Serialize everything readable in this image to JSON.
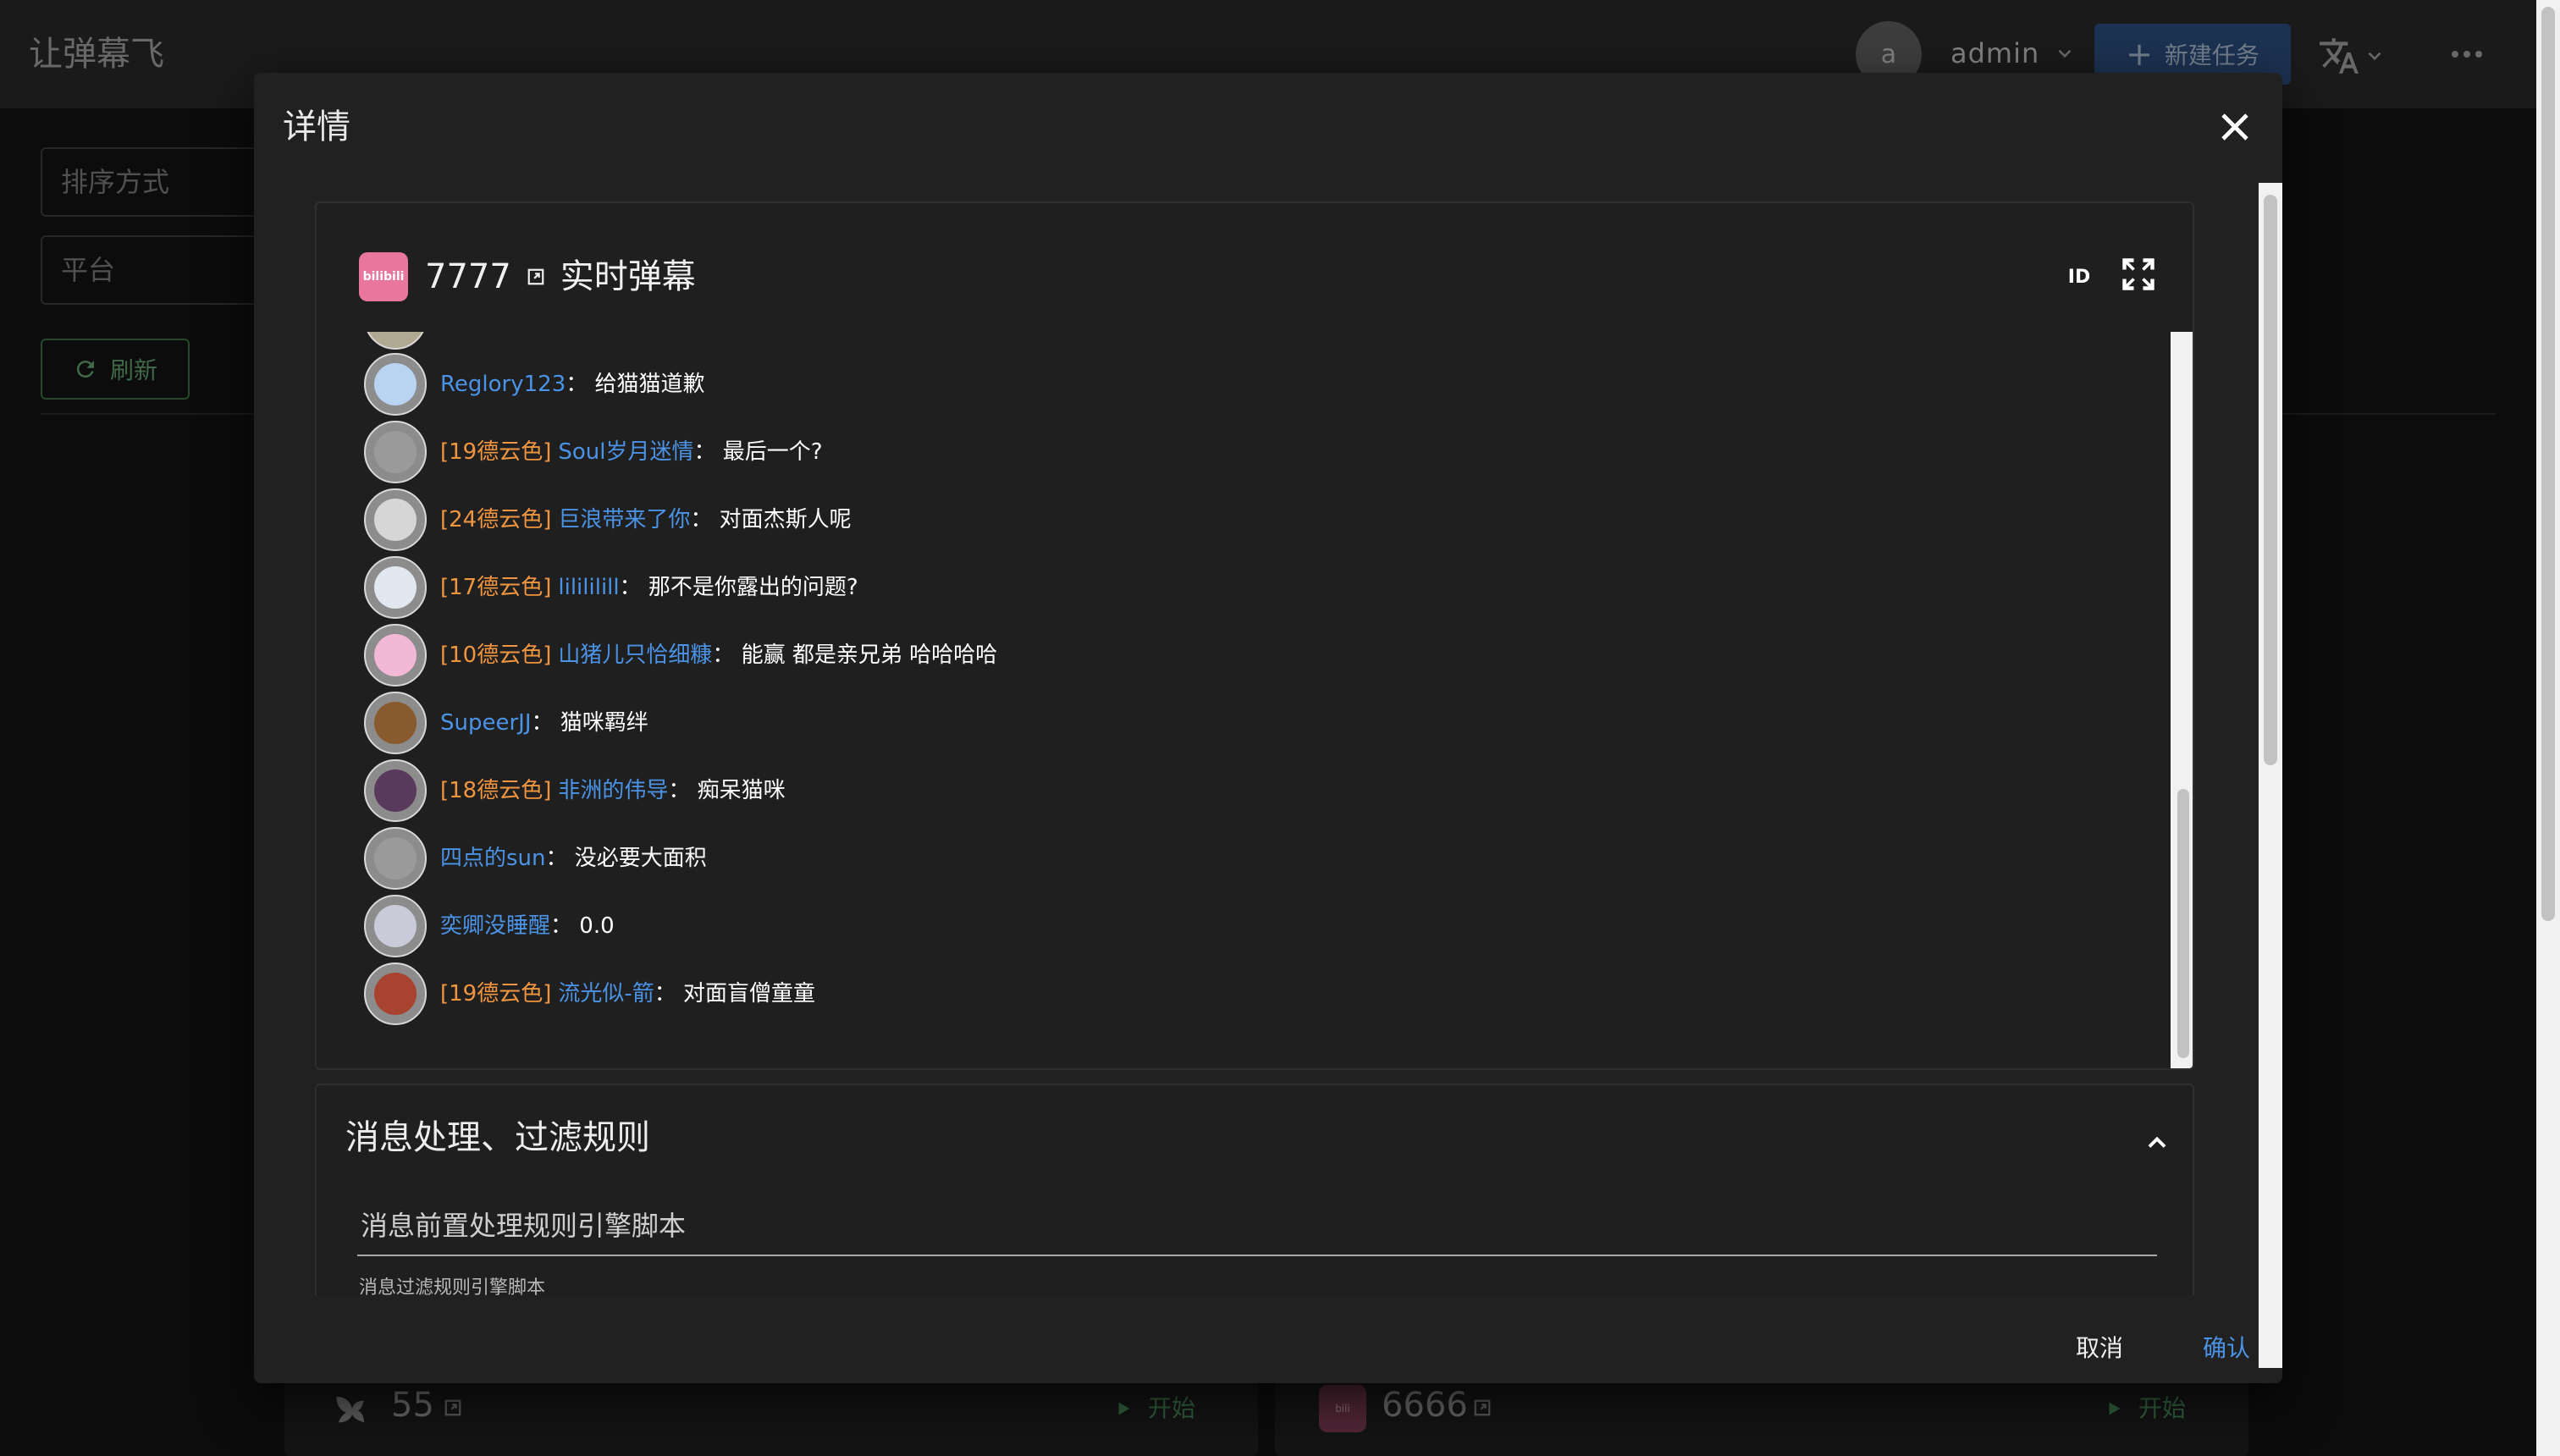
{
  "app": {
    "title": "让弹幕飞"
  },
  "header": {
    "avatar_letter": "a",
    "username": "admin",
    "new_task_label": "新建任务",
    "translate_icon": "translate-icon",
    "more_icon": "more-horiz-icon"
  },
  "filters": {
    "sort_placeholder": "排序方式",
    "platform_placeholder": "平台",
    "refresh_label": "刷新"
  },
  "tasks": [
    {
      "name": "55",
      "start_label": "开始",
      "platform": "douyu"
    },
    {
      "name": "6666",
      "start_label": "开始",
      "platform": "bilibili"
    }
  ],
  "dialog": {
    "title": "详情",
    "live": {
      "platform_logo_text": "bilibili",
      "room_id": "7777",
      "label": "实时弹幕",
      "id_toggle_text": "ID"
    },
    "messages": [
      {
        "medal": "",
        "user": "Reglory123",
        "content": "给猫猫道歉",
        "avatar_color": "#b9d3f2"
      },
      {
        "medal": "[19德云色]",
        "user": "Soul岁月迷情",
        "content": "最后一个?",
        "avatar_color": "#9a9a9a"
      },
      {
        "medal": "[24德云色]",
        "user": "巨浪带来了你",
        "content": "对面杰斯人呢",
        "avatar_color": "#d6d6d6"
      },
      {
        "medal": "[17德云色]",
        "user": "lilililill",
        "content": "那不是你露出的问题?",
        "avatar_color": "#e2e8ef"
      },
      {
        "medal": "[10德云色]",
        "user": "山猪儿只恰细糠",
        "content": "能赢 都是亲兄弟 哈哈哈哈",
        "avatar_color": "#f3b8d6"
      },
      {
        "medal": "",
        "user": "SupeerJJ",
        "content": "猫咪羁绊",
        "avatar_color": "#8a5a2f"
      },
      {
        "medal": "[18德云色]",
        "user": "非洲的伟导",
        "content": "痴呆猫咪",
        "avatar_color": "#5a3a5c"
      },
      {
        "medal": "",
        "user": "四点的sun",
        "content": "没必要大面积",
        "avatar_color": "#9a9a9a"
      },
      {
        "medal": "",
        "user": "奕卿没睡醒",
        "content": "0.0",
        "avatar_color": "#c9ccd8"
      },
      {
        "medal": "[19德云色]",
        "user": "流光似-箭",
        "content": "对面盲僧童童",
        "avatar_color": "#a8432f"
      }
    ],
    "rules": {
      "title": "消息处理、过滤规则",
      "pre_rule_label": "消息前置处理规则引擎脚本",
      "filter_rule_label": "消息过滤规则引擎脚本"
    },
    "actions": {
      "cancel": "取消",
      "confirm": "确认"
    }
  },
  "colors": {
    "medal": "#f0953f",
    "username": "#4b93e6",
    "primary": "#2a4a7a",
    "success": "#4b8f5a",
    "bilibili": "#e8769d"
  }
}
